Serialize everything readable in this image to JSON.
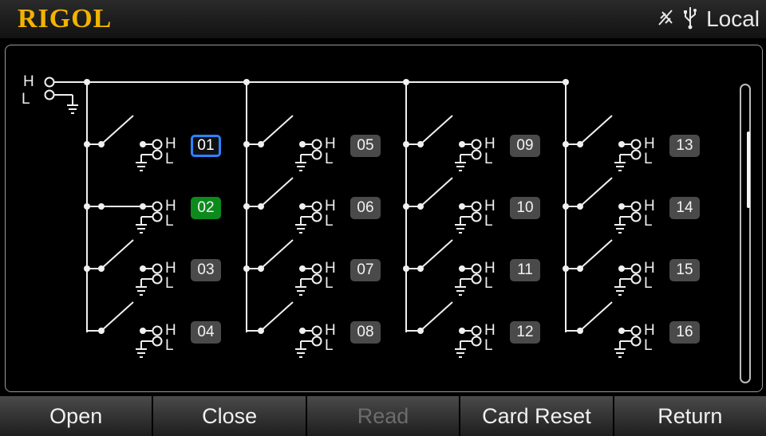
{
  "header": {
    "brand": "RIGOL",
    "status_text": "Local",
    "status_icons": [
      "signal-off-icon",
      "usb-icon"
    ]
  },
  "diagram": {
    "input_terminals": {
      "high": "H",
      "low": "L"
    },
    "channel_terminals": {
      "high": "H",
      "low": "L"
    },
    "channels": [
      {
        "label": "01",
        "state": "open",
        "selected": true
      },
      {
        "label": "02",
        "state": "closed",
        "selected": false
      },
      {
        "label": "03",
        "state": "open",
        "selected": false
      },
      {
        "label": "04",
        "state": "open",
        "selected": false
      },
      {
        "label": "05",
        "state": "open",
        "selected": false
      },
      {
        "label": "06",
        "state": "open",
        "selected": false
      },
      {
        "label": "07",
        "state": "open",
        "selected": false
      },
      {
        "label": "08",
        "state": "open",
        "selected": false
      },
      {
        "label": "09",
        "state": "open",
        "selected": false
      },
      {
        "label": "10",
        "state": "open",
        "selected": false
      },
      {
        "label": "11",
        "state": "open",
        "selected": false
      },
      {
        "label": "12",
        "state": "open",
        "selected": false
      },
      {
        "label": "13",
        "state": "open",
        "selected": false
      },
      {
        "label": "14",
        "state": "open",
        "selected": false
      },
      {
        "label": "15",
        "state": "open",
        "selected": false
      },
      {
        "label": "16",
        "state": "open",
        "selected": false
      }
    ]
  },
  "softkeys": [
    {
      "label": "Open",
      "enabled": true
    },
    {
      "label": "Close",
      "enabled": true
    },
    {
      "label": "Read",
      "enabled": false
    },
    {
      "label": "Card Reset",
      "enabled": true
    },
    {
      "label": "Return",
      "enabled": true
    }
  ],
  "colors": {
    "brand": "#f2b400",
    "selected_border": "#2a84ff",
    "closed_channel": "#0d8a1c",
    "channel_badge": "#4a4a4a",
    "disabled_text": "#6c6c6c"
  }
}
